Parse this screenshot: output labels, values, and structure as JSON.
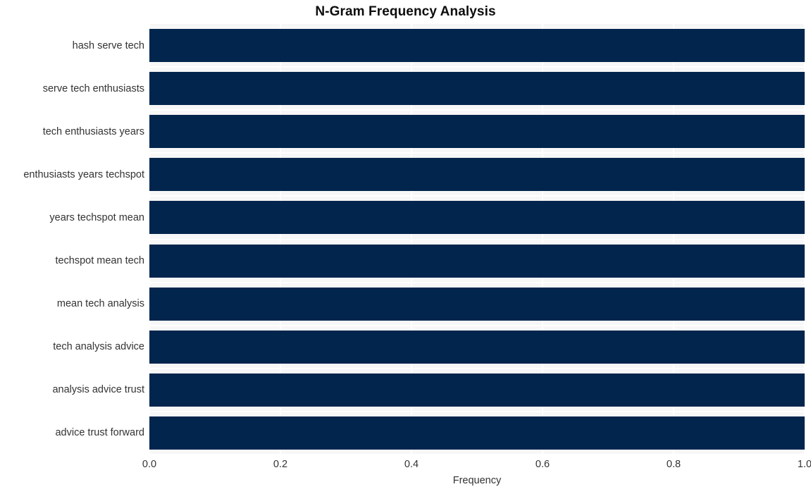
{
  "chart_data": {
    "type": "bar",
    "orientation": "horizontal",
    "title": "N-Gram Frequency Analysis",
    "xlabel": "Frequency",
    "ylabel": "",
    "categories": [
      "hash serve tech",
      "serve tech enthusiasts",
      "tech enthusiasts years",
      "enthusiasts years techspot",
      "years techspot mean",
      "techspot mean tech",
      "mean tech analysis",
      "tech analysis advice",
      "analysis advice trust",
      "advice trust forward"
    ],
    "values": [
      1.0,
      1.0,
      1.0,
      1.0,
      1.0,
      1.0,
      1.0,
      1.0,
      1.0,
      1.0
    ],
    "xlim": [
      0.0,
      1.0
    ],
    "xticks": [
      0.0,
      0.2,
      0.4,
      0.6,
      0.8,
      1.0
    ],
    "xtick_labels": [
      "0.0",
      "0.2",
      "0.4",
      "0.6",
      "0.8",
      "1.0"
    ],
    "grid": true,
    "legend": false,
    "bar_color": "#02254d",
    "plot_background": "#f7f7f7",
    "figure_background": "#ffffff",
    "gridline_color": "#ffffff",
    "text_color": "#333333",
    "title_color": "#0d0d0d"
  }
}
